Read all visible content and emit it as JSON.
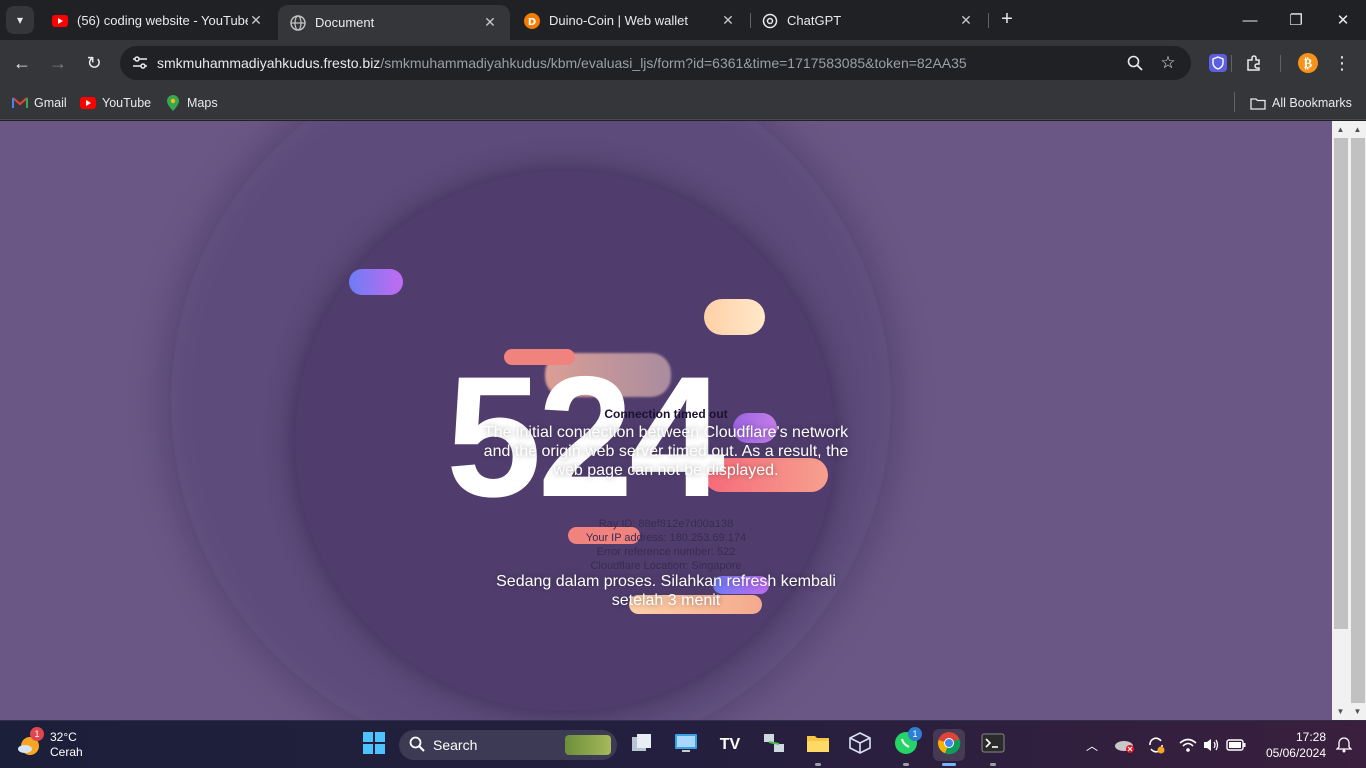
{
  "browser": {
    "tabs": [
      {
        "title": "(56) coding website - YouTube",
        "icon": "youtube-icon",
        "active": false
      },
      {
        "title": "Document",
        "icon": "globe-icon",
        "active": true
      },
      {
        "title": "Duino-Coin | Web wallet",
        "icon": "duino-icon",
        "active": false
      },
      {
        "title": "ChatGPT",
        "icon": "chatgpt-icon",
        "active": false
      }
    ],
    "url_host": "smkmuhammadiyahkudus.fresto.biz",
    "url_path": "/smkmuhammadiyahkudus/kbm/evaluasi_ljs/form?id=6361&time=1717583085&token=82AA35",
    "bookmarks": [
      {
        "label": "Gmail",
        "icon": "gmail-icon"
      },
      {
        "label": "YouTube",
        "icon": "youtube-icon"
      },
      {
        "label": "Maps",
        "icon": "maps-icon"
      }
    ],
    "all_bookmarks": "All Bookmarks"
  },
  "page": {
    "code": "524",
    "error_title": "Connection timed out",
    "error_desc": "The initial connection between Cloudflare's network and the origin web server timed out. As a result, the web page can not be displayed.",
    "ray_id": "Ray ID: 88ef812e7d00a138",
    "ip": "Your IP address: 180.253.69.174",
    "error_ref": "Error reference number: 522",
    "location": "Cloudflare Location: Singapore",
    "status": "Sedang dalam proses. Silahkan refresh kembali setelah 3 menit"
  },
  "taskbar": {
    "temp": "32°C",
    "weather": "Cerah",
    "weather_badge": "1",
    "search_label": "Search",
    "whatsapp_badge": "1",
    "time": "17:28",
    "date": "05/06/2024"
  },
  "colors": {
    "page_bg": "#6a5785",
    "ring_outer": "#5d4b7b",
    "ring_inner": "#503d6e",
    "accent_blue": "#6fb8ff"
  }
}
